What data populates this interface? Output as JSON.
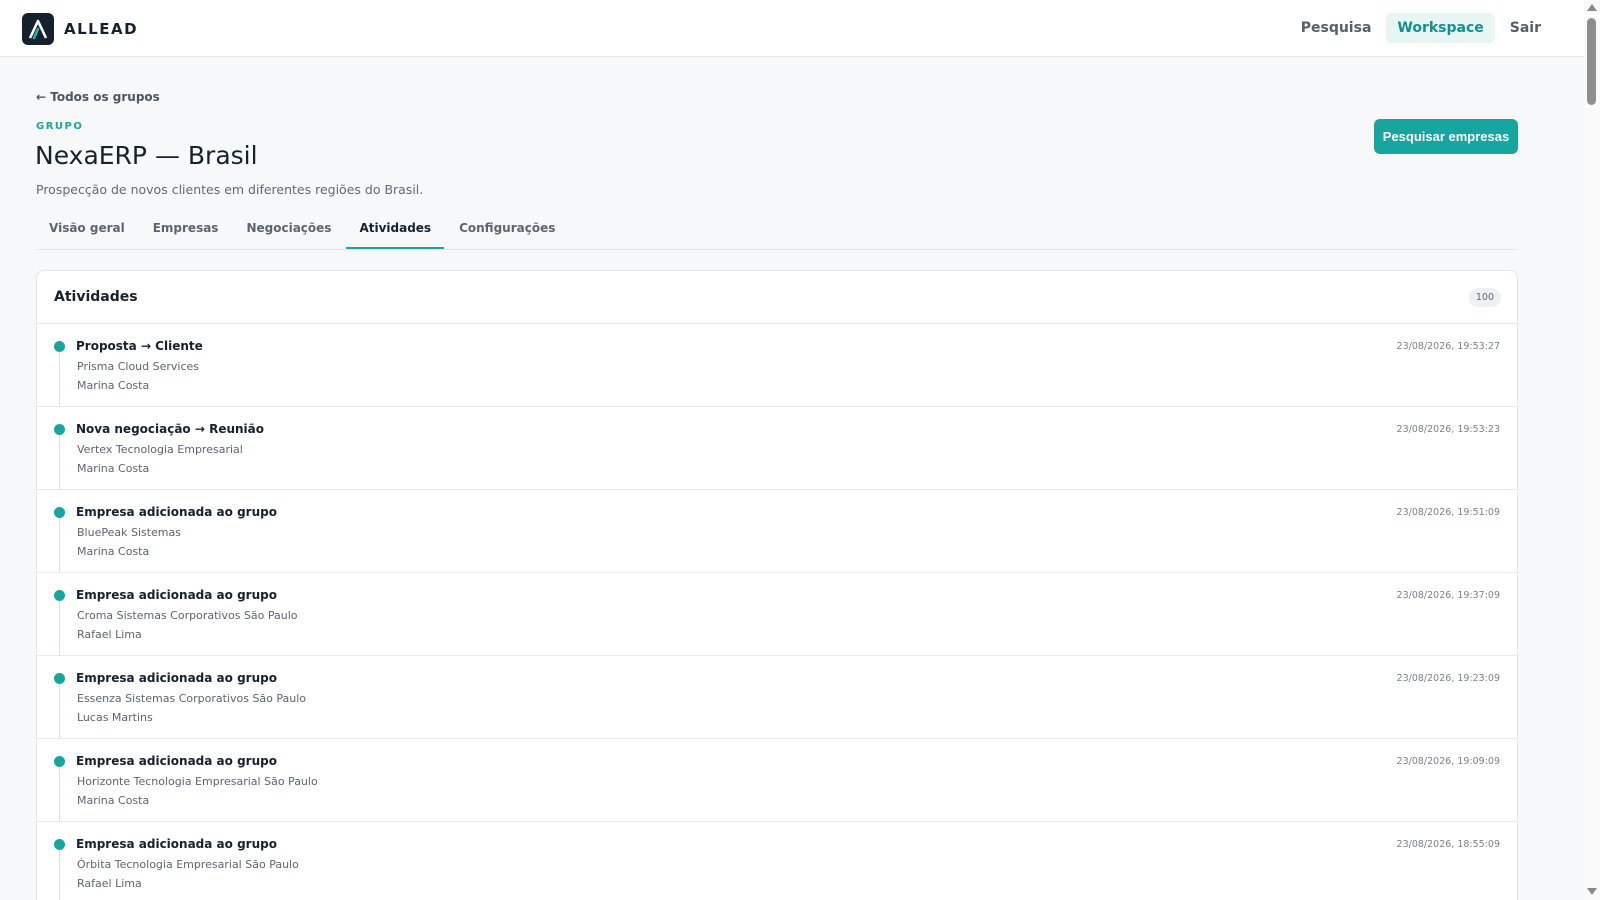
{
  "app": {
    "name": "ALLEAD"
  },
  "nav": {
    "links": [
      {
        "label": "Pesquisa",
        "active": false
      },
      {
        "label": "Workspace",
        "active": true
      },
      {
        "label": "Sair",
        "active": false
      }
    ]
  },
  "page": {
    "back_label": "← Todos os grupos",
    "eyebrow": "GRUPO",
    "title": "NexaERP — Brasil",
    "subtitle": "Prospecção de novos clientes em diferentes regiões do Brasil.",
    "primary_action": "Pesquisar empresas"
  },
  "tabs": [
    {
      "label": "Visão geral",
      "active": false
    },
    {
      "label": "Empresas",
      "active": false
    },
    {
      "label": "Negociações",
      "active": false
    },
    {
      "label": "Atividades",
      "active": true
    },
    {
      "label": "Configurações",
      "active": false
    }
  ],
  "activities": {
    "title": "Atividades",
    "count": "100",
    "items": [
      {
        "title": "Proposta → Cliente",
        "company": "Prisma Cloud Services",
        "user": "Marina Costa",
        "time": "23/08/2026, 19:53:27"
      },
      {
        "title": "Nova negociação → Reunião",
        "company": "Vertex Tecnologia Empresarial",
        "user": "Marina Costa",
        "time": "23/08/2026, 19:53:23"
      },
      {
        "title": "Empresa adicionada ao grupo",
        "company": "BluePeak Sistemas",
        "user": "Marina Costa",
        "time": "23/08/2026, 19:51:09"
      },
      {
        "title": "Empresa adicionada ao grupo",
        "company": "Croma Sistemas Corporativos São Paulo",
        "user": "Rafael Lima",
        "time": "23/08/2026, 19:37:09"
      },
      {
        "title": "Empresa adicionada ao grupo",
        "company": "Essenza Sistemas Corporativos São Paulo",
        "user": "Lucas Martins",
        "time": "23/08/2026, 19:23:09"
      },
      {
        "title": "Empresa adicionada ao grupo",
        "company": "Horizonte Tecnologia Empresarial São Paulo",
        "user": "Marina Costa",
        "time": "23/08/2026, 19:09:09"
      },
      {
        "title": "Empresa adicionada ao grupo",
        "company": "Órbita Tecnologia Empresarial São Paulo",
        "user": "Rafael Lima",
        "time": "23/08/2026, 18:55:09"
      }
    ]
  },
  "colors": {
    "accent": "#17a5a0",
    "brand_dark": "#16212e"
  },
  "icons": {
    "logo": "allead-logo-icon"
  }
}
